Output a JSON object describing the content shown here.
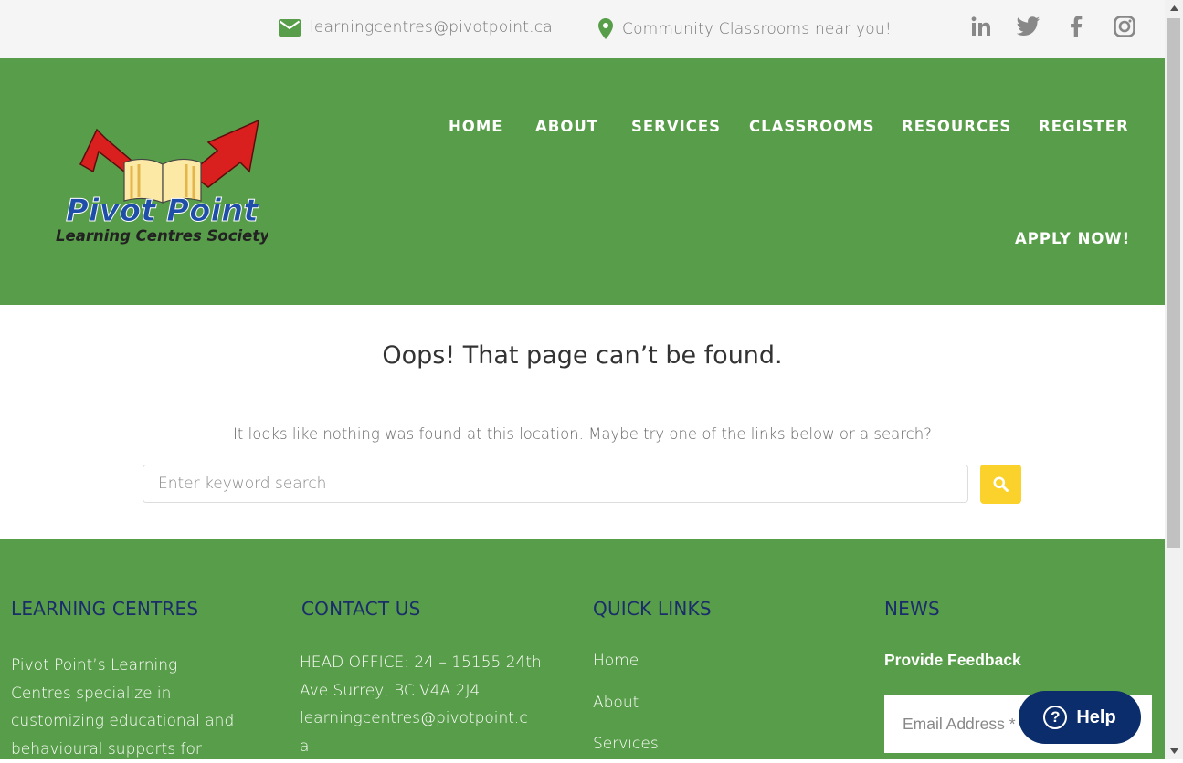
{
  "topbar": {
    "email": "learningcentres@pivotpoint.ca",
    "location": "Community Classrooms near you!",
    "icon_color": "#589d49",
    "social": [
      "linkedin-icon",
      "twitter-icon",
      "facebook-icon",
      "instagram-icon"
    ]
  },
  "logo": {
    "line1": "Pivot Point",
    "line2": "Learning Centres Society"
  },
  "nav": {
    "home": "HOME",
    "about": "ABOUT",
    "services": "SERVICES",
    "classrooms": "CLASSROOMS",
    "resources": "RESOURCES",
    "register": "REGISTER",
    "apply": "APPLY NOW!"
  },
  "main": {
    "title": "Oops! That page can’t be found.",
    "subtext": "It looks like nothing was found at this location. Maybe try one of the links below or a search?",
    "search_placeholder": "Enter keyword search",
    "search_button_color": "#fbd22b"
  },
  "footer": {
    "learning": {
      "title": "LEARNING CENTRES",
      "lines": [
        "Pivot Point’s Learning",
        "Centres specialize in",
        "customizing educational and",
        "behavioural supports for"
      ]
    },
    "contact": {
      "title": "CONTACT US",
      "lines": [
        "HEAD OFFICE: 24 – 15155 24th",
        "Ave Surrey, BC V4A 2J4",
        "learningcentres@pivotpoint.c",
        "a"
      ]
    },
    "quick_links": {
      "title": "QUICK LINKS",
      "links": [
        "Home",
        "About",
        "Services"
      ]
    },
    "news": {
      "title": "NEWS",
      "feedback": "Provide Feedback",
      "email_placeholder": "Email Address *"
    },
    "bg_color": "#589d49",
    "heading_color": "#1a2d6b"
  },
  "help": {
    "label": "Help",
    "color": "#0c2d6b"
  }
}
